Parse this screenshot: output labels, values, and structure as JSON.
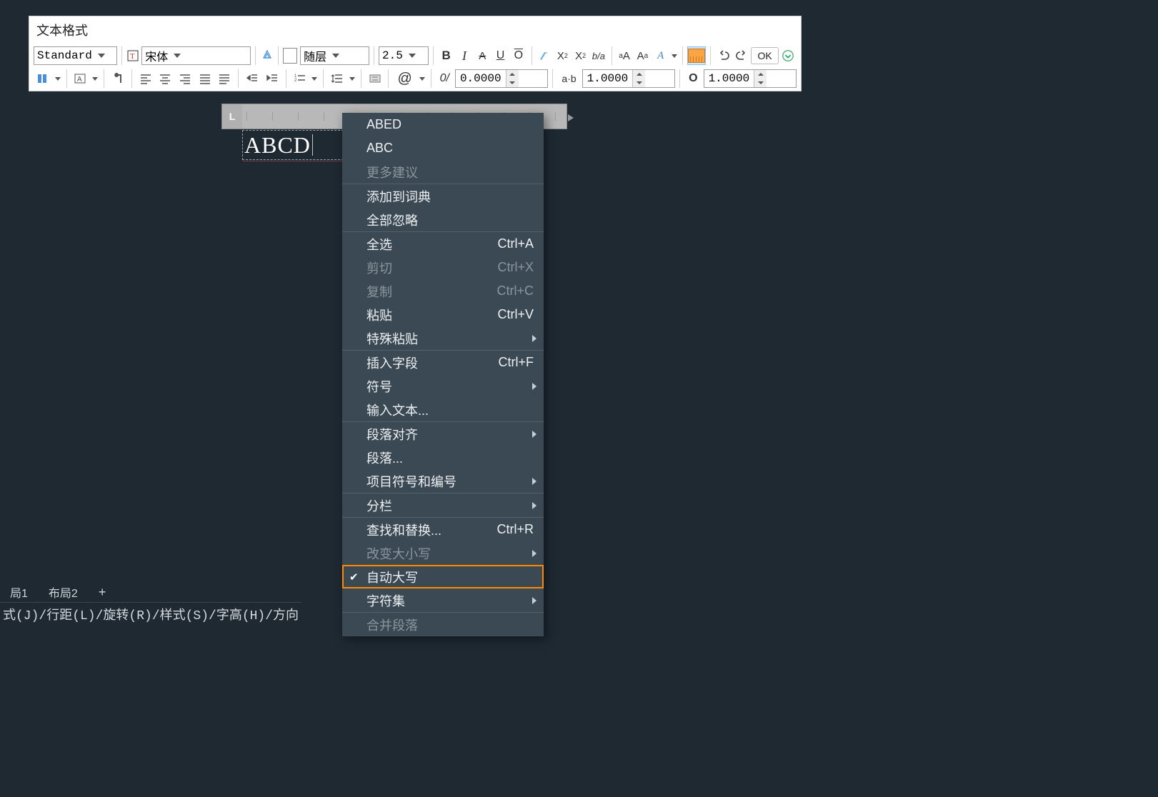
{
  "toolbar": {
    "title": "文本格式",
    "style_name": "Standard",
    "font_name": "宋体",
    "color_label": "随层",
    "text_height": "2.5",
    "bold": "B",
    "italic": "I",
    "strike": "A",
    "underline": "U",
    "overline": "O",
    "superscript": "X²",
    "subscript": "X₂",
    "fraction": "b/a",
    "ok_label": "OK",
    "at_label": "@",
    "oblique_label": "0/",
    "tracking_label": "a·b",
    "width_factor_label": "O",
    "oblique_value": "0.0000",
    "tracking_value": "1.0000",
    "width_value": "1.0000"
  },
  "canvas": {
    "text": "ABCD"
  },
  "menu": {
    "spell1": "ABED",
    "spell2": "ABC",
    "more_suggestions": "更多建议",
    "add_to_dict": "添加到词典",
    "ignore_all": "全部忽略",
    "select_all": "全选",
    "select_all_sc": "Ctrl+A",
    "cut": "剪切",
    "cut_sc": "Ctrl+X",
    "copy": "复制",
    "copy_sc": "Ctrl+C",
    "paste": "粘贴",
    "paste_sc": "Ctrl+V",
    "paste_special": "特殊粘贴",
    "insert_field": "插入字段",
    "insert_field_sc": "Ctrl+F",
    "symbol": "符号",
    "import_text": "输入文本...",
    "para_align": "段落对齐",
    "paragraph": "段落...",
    "bullets_numbering": "项目符号和编号",
    "columns": "分栏",
    "find_replace": "查找和替换...",
    "find_replace_sc": "Ctrl+R",
    "change_case": "改变大小写",
    "autocaps": "自动大写",
    "charset": "字符集",
    "merge_para": "合并段落"
  },
  "tabs": {
    "layout1": "局1",
    "layout2": "布局2",
    "plus": "+"
  },
  "cmdline": {
    "text": "式(J)/行距(L)/旋转(R)/样式(S)/字高(H)/方向"
  }
}
